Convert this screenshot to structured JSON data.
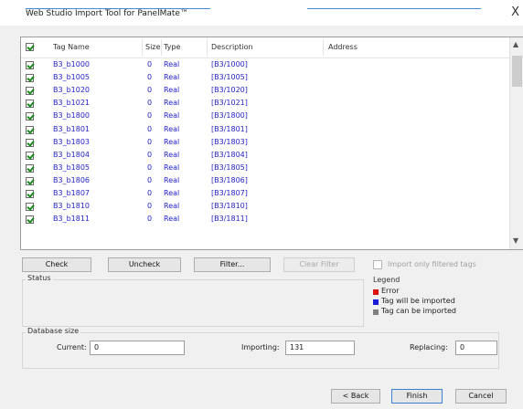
{
  "window": {
    "title": "Web Studio Import Tool for PanelMate™",
    "close_glyph": "X"
  },
  "table": {
    "columns": [
      "Tag Name",
      "Size",
      "Type",
      "Description",
      "Address"
    ],
    "rows": [
      {
        "checked": true,
        "name": "B3_b1000",
        "size": "0",
        "type": "Real",
        "description": "[B3/1000]",
        "address": ""
      },
      {
        "checked": true,
        "name": "B3_b1005",
        "size": "0",
        "type": "Real",
        "description": "[B3/1005]",
        "address": ""
      },
      {
        "checked": true,
        "name": "B3_b1020",
        "size": "0",
        "type": "Real",
        "description": "[B3/1020]",
        "address": ""
      },
      {
        "checked": true,
        "name": "B3_b1021",
        "size": "0",
        "type": "Real",
        "description": "[B3/1021]",
        "address": ""
      },
      {
        "checked": true,
        "name": "B3_b1800",
        "size": "0",
        "type": "Real",
        "description": "[B3/1800]",
        "address": ""
      },
      {
        "checked": true,
        "name": "B3_b1801",
        "size": "0",
        "type": "Real",
        "description": "[B3/1801]",
        "address": ""
      },
      {
        "checked": true,
        "name": "B3_b1803",
        "size": "0",
        "type": "Real",
        "description": "[B3/1803]",
        "address": ""
      },
      {
        "checked": true,
        "name": "B3_b1804",
        "size": "0",
        "type": "Real",
        "description": "[B3/1804]",
        "address": ""
      },
      {
        "checked": true,
        "name": "B3_b1805",
        "size": "0",
        "type": "Real",
        "description": "[B3/1805]",
        "address": ""
      },
      {
        "checked": true,
        "name": "B3_b1806",
        "size": "0",
        "type": "Real",
        "description": "[B3/1806]",
        "address": ""
      },
      {
        "checked": true,
        "name": "B3_b1807",
        "size": "0",
        "type": "Real",
        "description": "[B3/1807]",
        "address": ""
      },
      {
        "checked": true,
        "name": "B3_b1810",
        "size": "0",
        "type": "Real",
        "description": "[B3/1810]",
        "address": ""
      },
      {
        "checked": true,
        "name": "B3_b1811",
        "size": "0",
        "type": "Real",
        "description": "[B3/1811]",
        "address": ""
      }
    ]
  },
  "buttons": {
    "check": "Check",
    "uncheck": "Uncheck",
    "filter": "Filter...",
    "clear_filter": "Clear Filter",
    "back": "< Back",
    "finish": "Finish",
    "cancel": "Cancel"
  },
  "import_filtered_label": "Import only filtered tags",
  "status": {
    "title": "Status"
  },
  "legend": {
    "title": "Legend",
    "items": [
      {
        "label": "Error",
        "color": "#e01010"
      },
      {
        "label": "Tag will be imported",
        "color": "#1a1ad8"
      },
      {
        "label": "Tag can be imported",
        "color": "#808080"
      }
    ]
  },
  "database": {
    "title": "Database size",
    "current_label": "Current:",
    "current_value": "0",
    "importing_label": "Importing:",
    "importing_value": "131",
    "replacing_label": "Replacing:",
    "replacing_value": "0"
  }
}
